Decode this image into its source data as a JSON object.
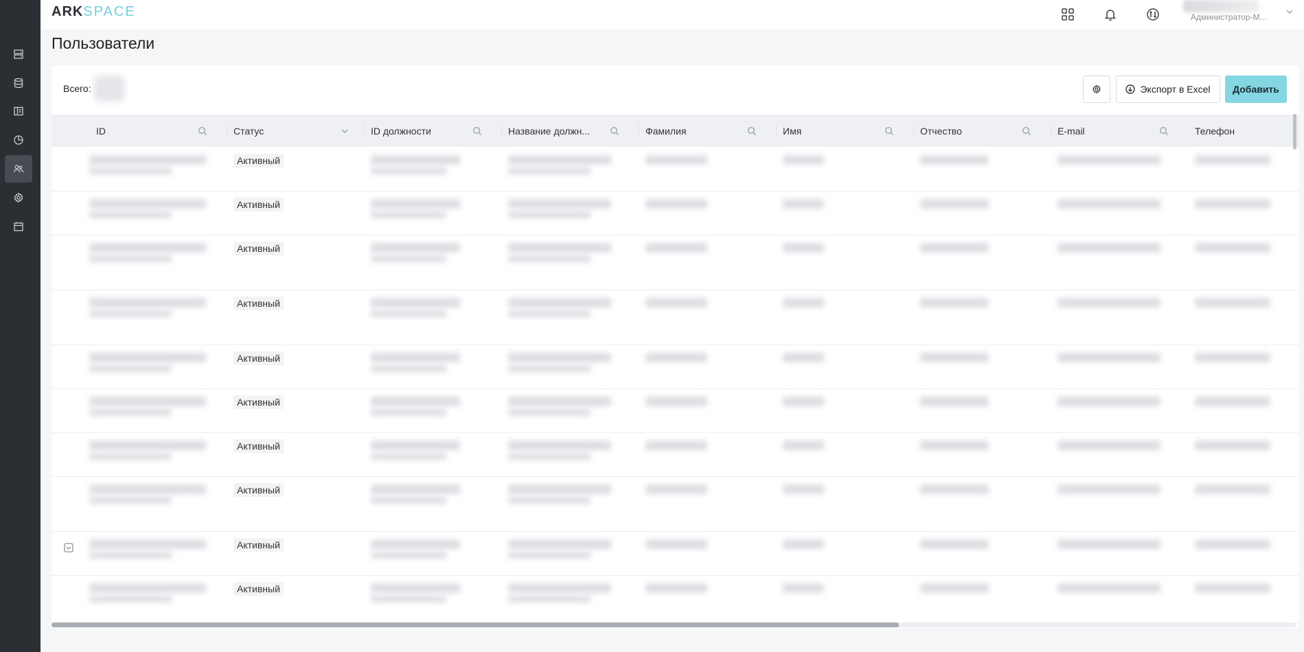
{
  "app": {
    "logo_part1": "ARK",
    "logo_part2": "SPACE",
    "accent_color": "#84d7e2"
  },
  "sidebar": {
    "items": [
      {
        "icon": "server-list-icon",
        "active": false
      },
      {
        "icon": "database-icon",
        "active": false
      },
      {
        "icon": "layout-icon",
        "active": false
      },
      {
        "icon": "pie-chart-icon",
        "active": false
      },
      {
        "icon": "users-icon",
        "active": true
      },
      {
        "icon": "gear-icon",
        "active": false
      },
      {
        "icon": "calendar-icon",
        "active": false
      }
    ]
  },
  "header": {
    "icons": [
      "apps-grid-icon",
      "bell-icon",
      "switch-icon"
    ],
    "user_role": "Администратор-М..."
  },
  "page": {
    "title": "Пользователи"
  },
  "toolbar": {
    "total_label": "Всего:",
    "export_label": "Экспорт в Excel",
    "add_label": "Добавить"
  },
  "table": {
    "columns": [
      {
        "label": "ID",
        "icon": "search-icon"
      },
      {
        "label": "Статус",
        "icon": "chevron-down-icon"
      },
      {
        "label": "ID должности",
        "icon": "search-icon"
      },
      {
        "label": "Название должн...",
        "icon": "search-icon"
      },
      {
        "label": "Фамилия",
        "icon": "search-icon"
      },
      {
        "label": "Имя",
        "icon": "search-icon"
      },
      {
        "label": "Отчество",
        "icon": "search-icon"
      },
      {
        "label": "E-mail",
        "icon": "search-icon"
      },
      {
        "label": "Телефон",
        "icon": ""
      }
    ],
    "rows": [
      {
        "status": "Активный"
      },
      {
        "status": "Активный"
      },
      {
        "status": "Активный"
      },
      {
        "status": "Активный"
      },
      {
        "status": "Активный"
      },
      {
        "status": "Активный"
      },
      {
        "status": "Активный"
      },
      {
        "status": "Активный"
      },
      {
        "status": "Активный",
        "has_icon": true
      },
      {
        "status": "Активный"
      }
    ]
  }
}
